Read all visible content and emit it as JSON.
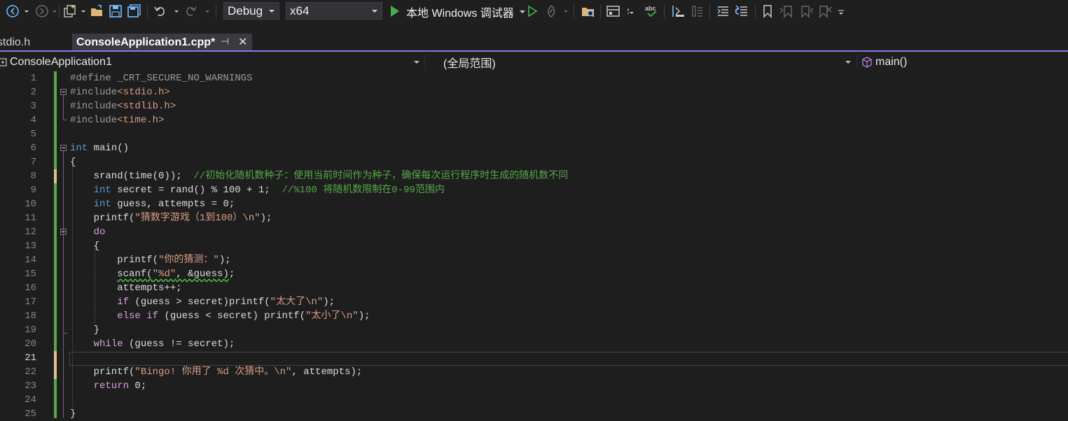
{
  "toolbar": {
    "config": "Debug",
    "platform": "x64",
    "run_label": "本地 Windows 调试器",
    "icons": [
      "back-icon",
      "forward-icon",
      "new-project-icon",
      "open-icon",
      "save-icon",
      "save-all-icon",
      "undo-icon",
      "redo-icon",
      "start-icon",
      "start-no-debug-icon",
      "hot-reload-icon",
      "solution-explorer-icon",
      "layout-icon",
      "spell-check-icon",
      "comment-icon",
      "uncomment-icon",
      "bookmark-icon"
    ]
  },
  "tabs": {
    "inactive": "stdio.h",
    "active": "ConsoleApplication1.cpp*",
    "pin_glyph": "⊣",
    "close_glyph": "✕"
  },
  "nav": {
    "project": "ConsoleApplication1",
    "scope": "(全局范围)",
    "member": "main()"
  },
  "editor": {
    "current_line": 21,
    "line_numbers": [
      "1",
      "2",
      "3",
      "4",
      "5",
      "6",
      "7",
      "8",
      "9",
      "10",
      "11",
      "12",
      "13",
      "14",
      "15",
      "16",
      "17",
      "18",
      "19",
      "20",
      "21",
      "22",
      "23",
      "24",
      "25"
    ],
    "lines": [
      {
        "n": 1,
        "tokens": [
          [
            "pp",
            "#define _CRT_SECURE_NO_WARNINGS"
          ]
        ]
      },
      {
        "n": 2,
        "tokens": [
          [
            "pp",
            "#include"
          ],
          [
            "str",
            "<stdio.h>"
          ]
        ]
      },
      {
        "n": 3,
        "tokens": [
          [
            "pp",
            "#include"
          ],
          [
            "str",
            "<stdlib.h>"
          ]
        ]
      },
      {
        "n": 4,
        "tokens": [
          [
            "pp",
            "#include"
          ],
          [
            "str",
            "<time.h>"
          ]
        ]
      },
      {
        "n": 5,
        "tokens": []
      },
      {
        "n": 6,
        "tokens": [
          [
            "kw",
            "int"
          ],
          [
            "t",
            " main()"
          ]
        ]
      },
      {
        "n": 7,
        "tokens": [
          [
            "t",
            "{"
          ]
        ]
      },
      {
        "n": 8,
        "tokens": [
          [
            "t",
            "    srand(time(0));  "
          ],
          [
            "cmt",
            "//初始化随机数种子：使用当前时间作为种子，确保每次运行程序时生成的随机数不同"
          ]
        ]
      },
      {
        "n": 9,
        "tokens": [
          [
            "t",
            "    "
          ],
          [
            "kw",
            "int"
          ],
          [
            "t",
            " secret = rand() % 100 + 1;  "
          ],
          [
            "cmt",
            "//%100 将随机数限制在0-99范围内"
          ]
        ]
      },
      {
        "n": 10,
        "tokens": [
          [
            "t",
            "    "
          ],
          [
            "kw",
            "int"
          ],
          [
            "t",
            " guess, attempts = 0;"
          ]
        ]
      },
      {
        "n": 11,
        "tokens": [
          [
            "t",
            "    printf("
          ],
          [
            "str",
            "\"猜数字游戏（1到100）\\n\""
          ],
          [
            "t",
            ");"
          ]
        ]
      },
      {
        "n": 12,
        "tokens": [
          [
            "t",
            "    "
          ],
          [
            "kwc",
            "do"
          ]
        ]
      },
      {
        "n": 13,
        "tokens": [
          [
            "t",
            "    {"
          ]
        ]
      },
      {
        "n": 14,
        "tokens": [
          [
            "t",
            "        printf("
          ],
          [
            "str",
            "\"你的猜测：\""
          ],
          [
            "t",
            ");"
          ]
        ]
      },
      {
        "n": 15,
        "tokens": [
          [
            "t",
            "        "
          ],
          [
            "sq",
            "scanf("
          ],
          [
            "sqs",
            "\"%d\""
          ],
          [
            "sq",
            ", &guess)"
          ],
          [
            "t",
            ";"
          ]
        ]
      },
      {
        "n": 16,
        "tokens": [
          [
            "t",
            "        attempts++;"
          ]
        ]
      },
      {
        "n": 17,
        "tokens": [
          [
            "t",
            "        "
          ],
          [
            "kwc",
            "if"
          ],
          [
            "t",
            " (guess > secret)printf("
          ],
          [
            "str",
            "\"太大了\\n\""
          ],
          [
            "t",
            ");"
          ]
        ]
      },
      {
        "n": 18,
        "tokens": [
          [
            "t",
            "        "
          ],
          [
            "kwc",
            "else"
          ],
          [
            "t",
            " "
          ],
          [
            "kwc",
            "if"
          ],
          [
            "t",
            " (guess < secret) printf("
          ],
          [
            "str",
            "\"太小了\\n\""
          ],
          [
            "t",
            ");"
          ]
        ]
      },
      {
        "n": 19,
        "tokens": [
          [
            "t",
            "    }"
          ]
        ]
      },
      {
        "n": 20,
        "tokens": [
          [
            "t",
            "    "
          ],
          [
            "kwc",
            "while"
          ],
          [
            "t",
            " (guess != secret);"
          ]
        ]
      },
      {
        "n": 21,
        "tokens": []
      },
      {
        "n": 22,
        "tokens": [
          [
            "t",
            "    printf("
          ],
          [
            "str",
            "\"Bingo! 你用了 %d 次猜中。\\n\""
          ],
          [
            "t",
            ", attempts);"
          ]
        ]
      },
      {
        "n": 23,
        "tokens": [
          [
            "t",
            "    "
          ],
          [
            "kwc",
            "return"
          ],
          [
            "t",
            " 0;"
          ]
        ]
      },
      {
        "n": 24,
        "tokens": []
      },
      {
        "n": 25,
        "tokens": [
          [
            "t",
            "}"
          ]
        ]
      }
    ]
  },
  "colors": {
    "accent": "#8a78e8",
    "changed_saved": "#57a64a",
    "changed_unsaved": "#e2c08d"
  }
}
